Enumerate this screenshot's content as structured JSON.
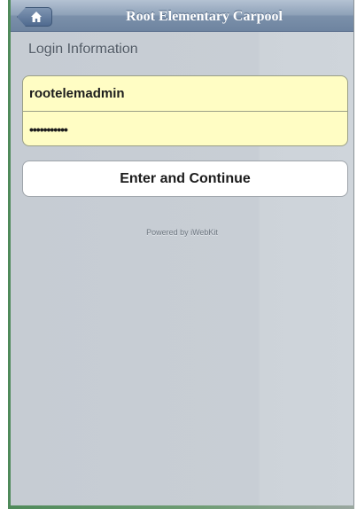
{
  "header": {
    "title": "Root Elementary Carpool",
    "home_icon": "home-icon"
  },
  "login": {
    "section_title": "Login Information",
    "username_value": "rootelemadmin",
    "password_value": "•••••••••••"
  },
  "actions": {
    "continue_label": "Enter and Continue"
  },
  "footer": {
    "text": "Powered by iWebKit"
  },
  "colors": {
    "topbar": "#8ea1b8",
    "background": "#c8ced5",
    "input_fill": "#fffdc4",
    "accent_green": "#4f8a5a"
  }
}
